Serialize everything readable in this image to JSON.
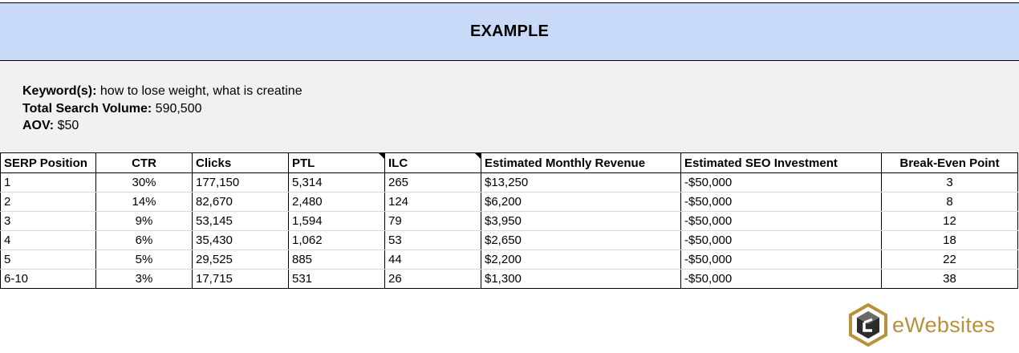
{
  "header": {
    "title": "EXAMPLE"
  },
  "info": {
    "keywords_label": "Keyword(s):",
    "keywords_value": " how to lose weight, what is creatine",
    "volume_label": "Total Search Volume:",
    "volume_value": " 590,500",
    "aov_label": "AOV:",
    "aov_value": " $50"
  },
  "table": {
    "headers": [
      "SERP Position",
      "CTR",
      "Clicks",
      "PTL",
      "ILC",
      "Estimated Monthly Revenue",
      "Estimated SEO Investment",
      "Break-Even Point"
    ],
    "rows": [
      [
        "1",
        "30%",
        "177,150",
        "5,314",
        "265",
        "$13,250",
        "-$50,000",
        "3"
      ],
      [
        "2",
        "14%",
        "82,670",
        "2,480",
        "124",
        "$6,200",
        "-$50,000",
        "8"
      ],
      [
        "3",
        "9%",
        "53,145",
        "1,594",
        "79",
        "$3,950",
        "-$50,000",
        "12"
      ],
      [
        "4",
        "6%",
        "35,430",
        "1,062",
        "53",
        "$2,650",
        "-$50,000",
        "18"
      ],
      [
        "5",
        "5%",
        "29,525",
        "885",
        "44",
        "$2,200",
        "-$50,000",
        "22"
      ],
      [
        "6-10",
        "3%",
        "17,715",
        "531",
        "26",
        "$1,300",
        "-$50,000",
        "38"
      ]
    ]
  },
  "logo": {
    "text": "eWebsites",
    "icon": "cube-hexagon-logo-icon",
    "color": "#b8913a"
  },
  "colors": {
    "header_bg": "#c9daf8",
    "info_bg": "#f1f1f4"
  }
}
